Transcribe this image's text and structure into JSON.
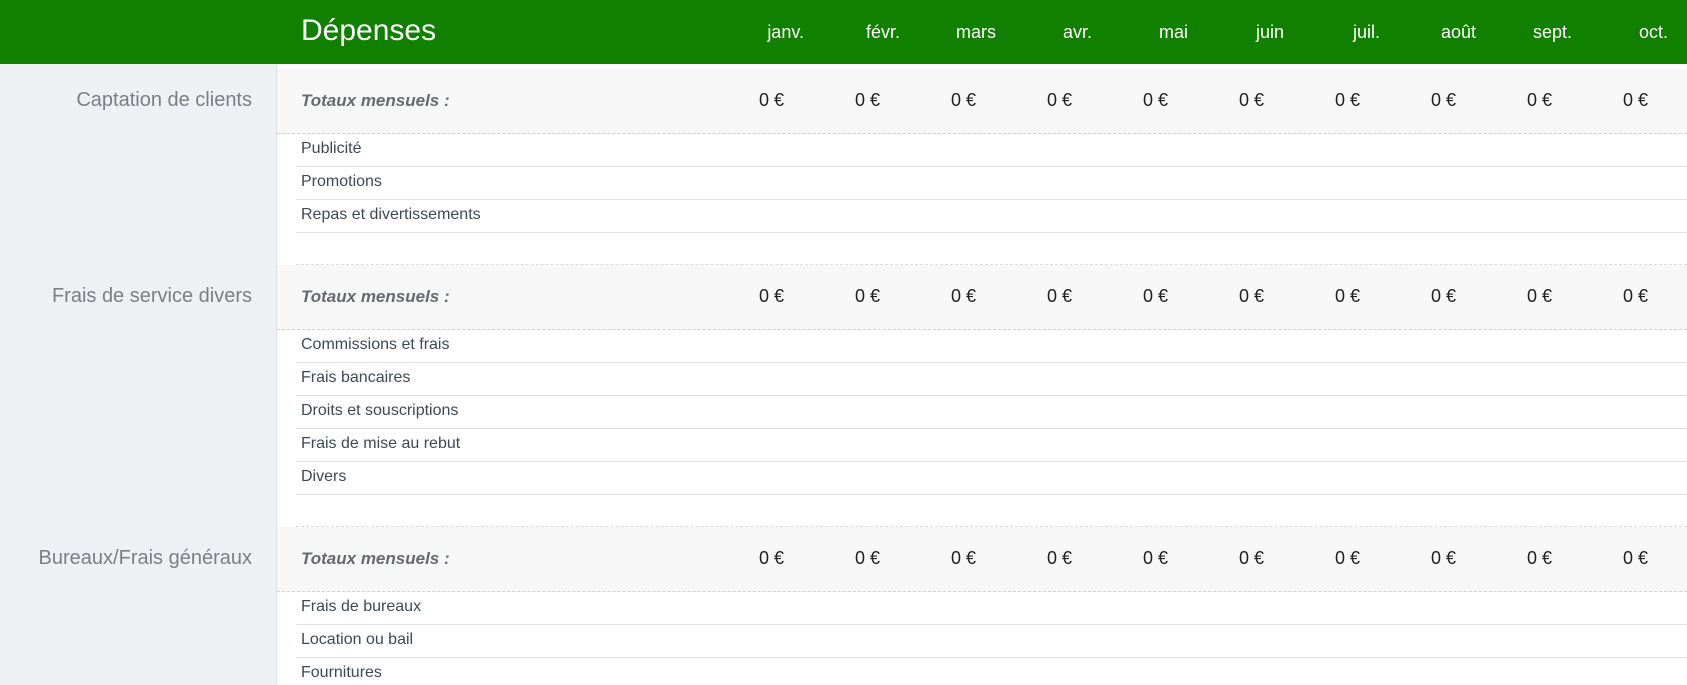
{
  "header": {
    "title": "Dépenses",
    "months": [
      "janv.",
      "févr.",
      "mars",
      "avr.",
      "mai",
      "juin",
      "juil.",
      "août",
      "sept.",
      "oct."
    ],
    "color": "#117f00"
  },
  "sections": [
    {
      "title": "Captation de clients",
      "totals_label": "Totaux mensuels :",
      "totals": [
        "0 €",
        "0 €",
        "0 €",
        "0 €",
        "0 €",
        "0 €",
        "0 €",
        "0 €",
        "0 €",
        "0 €"
      ],
      "items": [
        "Publicité",
        "Promotions",
        "Repas et divertissements"
      ]
    },
    {
      "title": "Frais de service divers",
      "totals_label": "Totaux mensuels :",
      "totals": [
        "0 €",
        "0 €",
        "0 €",
        "0 €",
        "0 €",
        "0 €",
        "0 €",
        "0 €",
        "0 €",
        "0 €"
      ],
      "items": [
        "Commissions et frais",
        "Frais bancaires",
        "Droits et souscriptions",
        "Frais de mise au rebut",
        "Divers"
      ]
    },
    {
      "title": "Bureaux/Frais généraux",
      "totals_label": "Totaux mensuels :",
      "totals": [
        "0 €",
        "0 €",
        "0 €",
        "0 €",
        "0 €",
        "0 €",
        "0 €",
        "0 €",
        "0 €",
        "0 €"
      ],
      "items": [
        "Frais de bureaux",
        "Location ou bail",
        "Fournitures"
      ]
    }
  ]
}
